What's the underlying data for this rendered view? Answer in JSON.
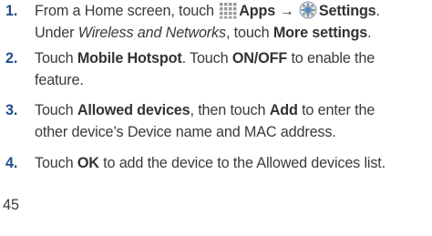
{
  "steps": [
    {
      "number": "1.",
      "line1": {
        "prefix": "From a Home screen, touch",
        "apps_label": "Apps",
        "arrow": "→",
        "settings_label": "Settings",
        "period": "."
      },
      "line2": {
        "under": "Under",
        "wireless": "Wireless and Networks",
        "touch": ", touch",
        "more_settings": "More settings",
        "period": "."
      },
      "icons": [
        "apps-grid-icon",
        "settings-gear-icon"
      ]
    },
    {
      "number": "2.",
      "touch1": "Touch",
      "mobile_hotspot": "Mobile Hotspot",
      "touch2": ". Touch",
      "on_off": "ON/OFF",
      "rest_line1": "to enable the",
      "rest_line2": "feature."
    },
    {
      "number": "3.",
      "touch1": "Touch",
      "allowed_devices": "Allowed devices",
      "then_touch": ", then touch",
      "add": "Add",
      "rest_line1": "to enter the",
      "rest_line2": "other device’s Device name and MAC address."
    },
    {
      "number": "4.",
      "touch1": "Touch",
      "ok": "OK",
      "rest": "to add the device to the Allowed devices list."
    }
  ],
  "page_number": "45",
  "colors": {
    "step_number": "#1f4e8c",
    "text": "#3a3a3a"
  }
}
